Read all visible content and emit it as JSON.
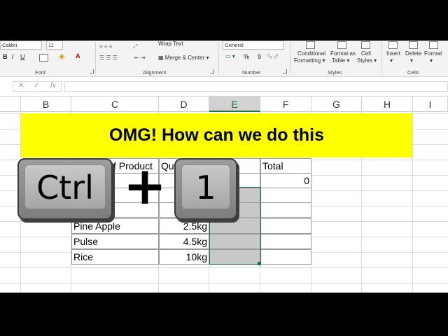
{
  "ribbon": {
    "font_name": "Calibri",
    "font_size": "11",
    "bold": "B",
    "italic": "I",
    "underline": "U",
    "font_group_label": "Font",
    "wrap_text": "Wrap Text",
    "merge_center": "Merge & Center",
    "alignment_group_label": "Alignment",
    "number_format": "General",
    "percent": "%",
    "comma": "9",
    "number_group_label": "Number",
    "conditional_formatting": [
      "Conditional",
      "Formatting"
    ],
    "format_as_table": [
      "Format as",
      "Table"
    ],
    "cell_styles": [
      "Cell",
      "Styles"
    ],
    "styles_group_label": "Styles",
    "insert": "Insert",
    "delete": "Delete",
    "format": "Format",
    "cells_group_label": "Cells"
  },
  "formula_bar": {
    "cancel": "✕",
    "enter": "✓",
    "fx": "fx",
    "value": ""
  },
  "columns": [
    "B",
    "C",
    "D",
    "E",
    "F",
    "G",
    "H",
    "I"
  ],
  "selected_column": "E",
  "banner_text": "OMG! How can we do this",
  "table": {
    "header_product": "Name of Product",
    "header_product_visible": "f Product",
    "header_quantity_visible": "Qua",
    "header_total": "Total",
    "total_value": "0",
    "rows": [
      {
        "product": "Pine Apple",
        "quantity": "2.5kg"
      },
      {
        "product": "Pulse",
        "quantity": "4.5kg"
      },
      {
        "product": "Rice",
        "quantity": "10kg"
      }
    ]
  },
  "shortcut": {
    "key1": "Ctrl",
    "plus": "+",
    "key2": "1"
  },
  "colors": {
    "banner": "#ffff00",
    "accent": "#217346",
    "selection": "#c8c8c8"
  }
}
